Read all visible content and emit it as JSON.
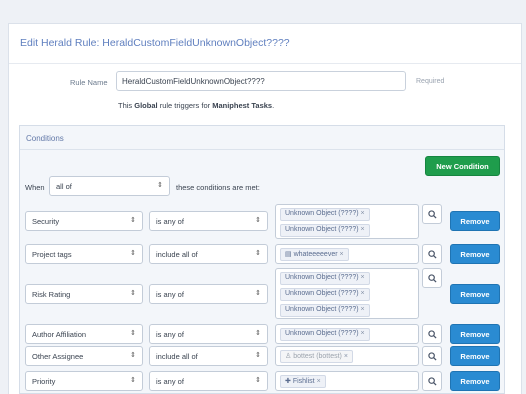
{
  "title": "Edit Herald Rule: HeraldCustomFieldUnknownObject????",
  "rule_name": {
    "label": "Rule Name",
    "value": "HeraldCustomFieldUnknownObject????",
    "required": "Required"
  },
  "summary": {
    "pre": "This ",
    "scope": "Global",
    "mid": " rule triggers for ",
    "target": "Maniphest Tasks",
    "post": "."
  },
  "conditions": {
    "title": "Conditions",
    "new_button": "New Condition",
    "when_label": "When",
    "when_value": "all of",
    "when_tail": "these conditions are met:",
    "remove_label": "Remove",
    "rows": [
      {
        "field": "Security",
        "op": "is any of",
        "tokens": [
          "Unknown Object (????)",
          "Unknown Object (????)"
        ]
      },
      {
        "field": "Project tags",
        "op": "include all of",
        "tokens": [
          "whateeeeever"
        ]
      },
      {
        "field": "Risk Rating",
        "op": "is any of",
        "tokens": [
          "Unknown Object (????)",
          "Unknown Object (????)",
          "Unknown Object (????)"
        ]
      },
      {
        "field": "Author Affiliation",
        "op": "is any of",
        "tokens": [
          "Unknown Object (????)"
        ]
      },
      {
        "field": "Other Assignee",
        "op": "include all of",
        "tokens": [
          "bottest (bottest)"
        ]
      },
      {
        "field": "Priority",
        "op": "is any of",
        "tokens": [
          "Fishlist"
        ]
      }
    ]
  },
  "icons": {
    "select_arrow": "updown-arrow-icon",
    "search": "search-icon",
    "remove_token": "close-icon",
    "project": "briefcase-icon",
    "user": "user-icon",
    "plus": "plus-icon"
  }
}
